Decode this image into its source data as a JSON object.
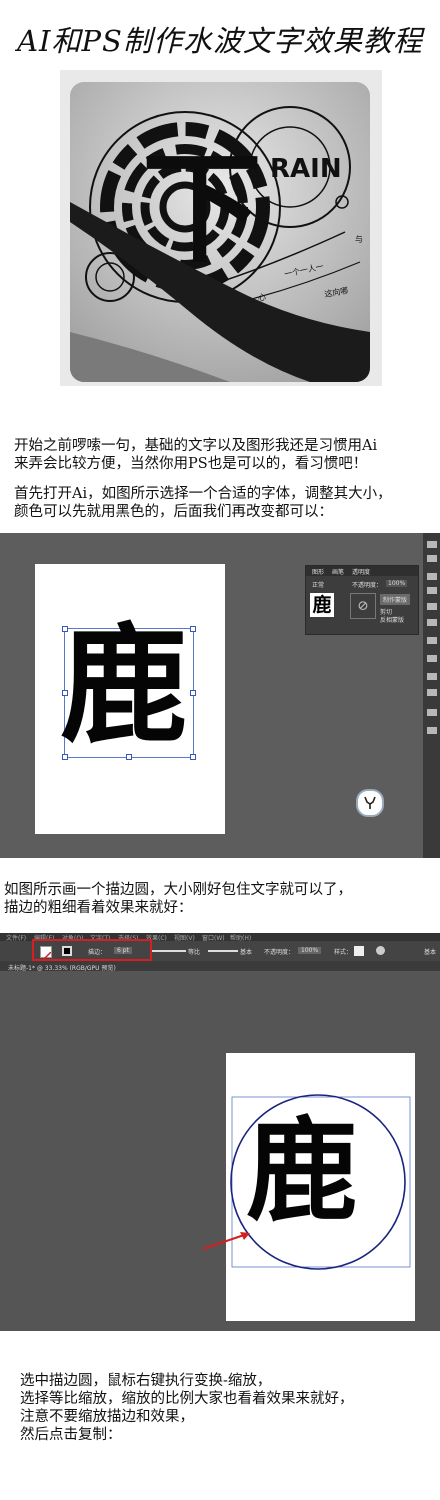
{
  "page": {
    "title": "AI和PS制作水波文字效果教程",
    "intro_text": "开始之前啰嗦一句，基础的文字以及图形我还是习惯用Ai\n来弄会比较方便，当然你用PS也是可以的，看习惯吧！",
    "step1_text": "首先打开Ai，如图所示选择一个合适的字体，调整其大小，\n颜色可以先就用黑色的，后面我们再改变都可以：",
    "step2_text": "如图所示画一个描边圆，大小刚好包住文字就可以了，\n描边的粗细看着效果来就好：",
    "step3_text": "选中描边圆，鼠标右键执行变换-缩放，\n选择等比缩放，缩放的比例大家也看着效果来就好，\n注意不要缩放描边和效果，\n然后点击复制："
  },
  "hero": {
    "rain_label": "RAIN",
    "big_char": "下",
    "curve_text_1": "一个一人一",
    "curve_text_2": "心",
    "curve_text_3": "这向哪",
    "curve_text_4": "与"
  },
  "screenshot1": {
    "glyph": "鹿",
    "panel_tabs": [
      "图形",
      "画笔",
      "透明度"
    ],
    "blend_mode": "正常",
    "opacity_label": "不透明度：",
    "opacity_value": "100%",
    "make_mask_button": "制作蒙版",
    "clip_label": "剪切",
    "invert_label": "反相蒙版",
    "thumb_glyph": "鹿"
  },
  "screenshot2": {
    "glyph": "鹿",
    "menu_items": [
      "文件(F)",
      "编辑(E)",
      "对象(O)",
      "文字(T)",
      "选择(S)",
      "效果(C)",
      "视图(V)",
      "窗口(W)",
      "帮助(H)"
    ],
    "stroke_label": "描边：",
    "stroke_value": "6 pt",
    "uniform_label": "等比",
    "basic_label": "基本",
    "opacity_label": "不透明度：",
    "opacity_value": "100%",
    "style_label": "样式：",
    "doc_tab": "未标题-1* @ 33.33% (RGB/GPU 预览)",
    "far_right_label": "基本"
  },
  "colors": {
    "annotation_red": "#d62020",
    "selection_blue": "#3a56b6",
    "ai_canvas": "#5d5d5d"
  }
}
